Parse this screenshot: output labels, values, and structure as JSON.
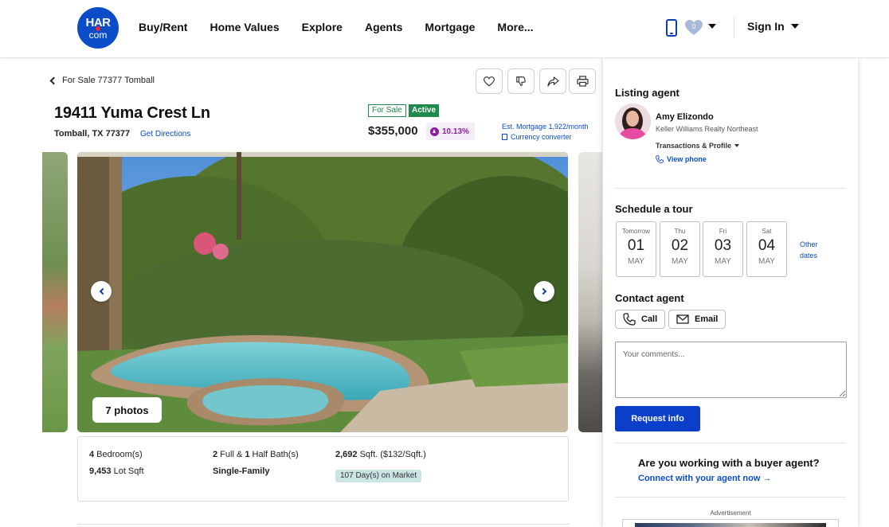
{
  "header": {
    "logo_top": "HAR",
    "logo_bottom": "com",
    "nav": [
      "Buy/Rent",
      "Home Values",
      "Explore",
      "Agents",
      "Mortgage",
      "More..."
    ],
    "favorites_count": "0",
    "sign_in": "Sign In"
  },
  "breadcrumb": "For Sale 77377 Tomball",
  "listing": {
    "address": "19411 Yuma Crest Ln",
    "city_state_zip": "Tomball, TX 77377",
    "get_directions": "Get Directions",
    "status_type": "For Sale",
    "status": "Active",
    "price": "$355,000",
    "price_change": "10.13%",
    "est_mortgage": "Est. Mortgage 1,922/month",
    "currency_converter": "Currency converter",
    "photos_button": "7 photos"
  },
  "facts": {
    "bed_num": "4",
    "bed_label": " Bedroom(s)",
    "bath_full_num": "2",
    "bath_full_label": " Full & ",
    "bath_half_num": "1",
    "bath_half_label": " Half Bath(s)",
    "sqft_num": "2,692",
    "sqft_label": " Sqft. ($132/Sqft.)",
    "lot_num": "9,453",
    "lot_label": " Lot Sqft",
    "type": "Single-Family",
    "days_on_market": "107 Day(s) on Market"
  },
  "panel": {
    "listing_agent_heading": "Listing agent",
    "agent_name": "Amy Elizondo",
    "agent_company": "Keller Williams Realty Northeast",
    "transactions": "Transactions & Profile",
    "view_phone": "View phone",
    "schedule_heading": "Schedule a tour",
    "days": [
      {
        "name": "Tomorrow",
        "date": "01",
        "month": "MAY"
      },
      {
        "name": "Thu",
        "date": "02",
        "month": "MAY"
      },
      {
        "name": "Fri",
        "date": "03",
        "month": "MAY"
      },
      {
        "name": "Sat",
        "date": "04",
        "month": "MAY"
      }
    ],
    "other_dates_1": "Other",
    "other_dates_2": "dates",
    "contact_heading": "Contact agent",
    "call": "Call",
    "email": "Email",
    "comments_placeholder": "Your comments...",
    "request_info": "Request info",
    "buyer_question": "Are you working with a buyer agent?",
    "connect": "Connect with your agent now →",
    "advertisement": "Advertisement"
  },
  "colors": {
    "brand_blue": "#0b4dc9",
    "active_green": "#1f8a4c",
    "price_up_purple": "#8a1f9c"
  }
}
